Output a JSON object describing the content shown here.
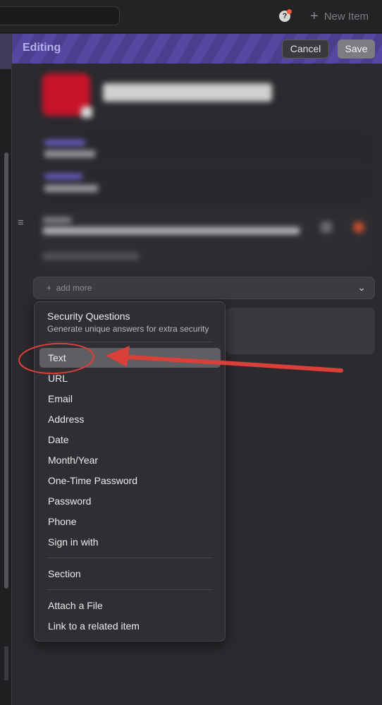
{
  "topbar": {
    "notification_glyph": "?",
    "new_item_label": "New Item"
  },
  "editbar": {
    "title": "Editing",
    "cancel_label": "Cancel",
    "save_label": "Save"
  },
  "add_more": {
    "label": "add more",
    "chevron": "⌄"
  },
  "menu": {
    "security_questions": {
      "title": "Security Questions",
      "subtitle": "Generate unique answers for extra security"
    },
    "items": [
      "Text",
      "URL",
      "Email",
      "Address",
      "Date",
      "Month/Year",
      "One-Time Password",
      "Password",
      "Phone",
      "Sign in with"
    ],
    "highlighted": "Text",
    "section": "Section",
    "attach": "Attach a File",
    "link_related": "Link to a related item"
  },
  "colors": {
    "accent_purple": "#5548a0",
    "annotation_red": "#d9403a",
    "highlight": "#5f5e63"
  }
}
